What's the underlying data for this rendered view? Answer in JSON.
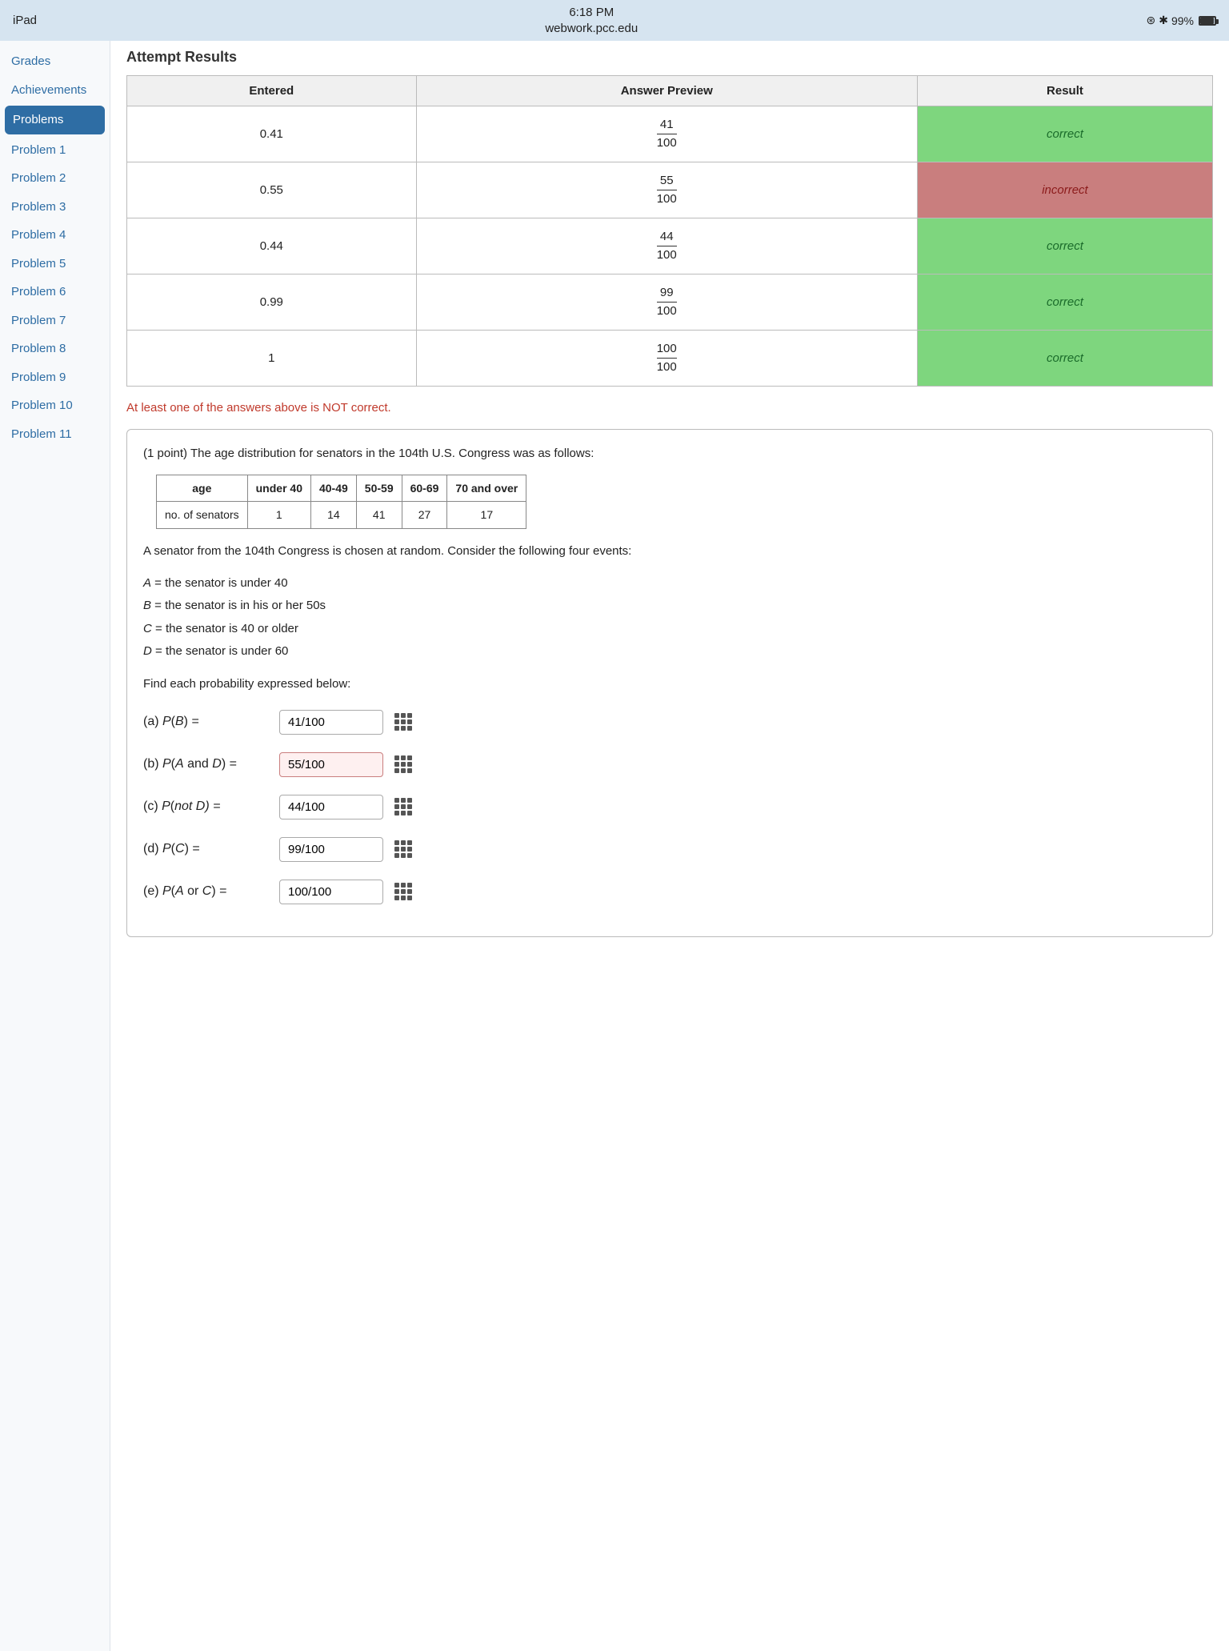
{
  "statusBar": {
    "left": "iPad",
    "centerLine1": "6:18 PM",
    "centerLine2": "webwork.pcc.edu",
    "batteryPercent": "99%"
  },
  "sidebar": {
    "items": [
      {
        "id": "grades",
        "label": "Grades",
        "active": false
      },
      {
        "id": "achievements",
        "label": "Achievements",
        "active": false
      },
      {
        "id": "problems",
        "label": "Problems",
        "active": true
      },
      {
        "id": "problem1",
        "label": "Problem 1",
        "active": false
      },
      {
        "id": "problem2",
        "label": "Problem 2",
        "active": false
      },
      {
        "id": "problem3",
        "label": "Problem 3",
        "active": false
      },
      {
        "id": "problem4",
        "label": "Problem 4",
        "active": false
      },
      {
        "id": "problem5",
        "label": "Problem 5",
        "active": false
      },
      {
        "id": "problem6",
        "label": "Problem 6",
        "active": false
      },
      {
        "id": "problem7",
        "label": "Problem 7",
        "active": false
      },
      {
        "id": "problem8",
        "label": "Problem 8",
        "active": false
      },
      {
        "id": "problem9",
        "label": "Problem 9",
        "active": false
      },
      {
        "id": "problem10",
        "label": "Problem 10",
        "active": false
      },
      {
        "id": "problem11",
        "label": "Problem 11",
        "active": false
      }
    ]
  },
  "pageTitle": "Attempt Results",
  "resultsTable": {
    "headers": [
      "Entered",
      "Answer Preview",
      "Result"
    ],
    "rows": [
      {
        "entered": "0.41",
        "numerator": "41",
        "denominator": "100",
        "result": "correct",
        "status": "correct"
      },
      {
        "entered": "0.55",
        "numerator": "55",
        "denominator": "100",
        "result": "incorrect",
        "status": "incorrect"
      },
      {
        "entered": "0.44",
        "numerator": "44",
        "denominator": "100",
        "result": "correct",
        "status": "correct"
      },
      {
        "entered": "0.99",
        "numerator": "99",
        "denominator": "100",
        "result": "correct",
        "status": "correct"
      },
      {
        "entered": "1",
        "numerator": "100",
        "denominator": "100",
        "result": "correct",
        "status": "correct"
      }
    ]
  },
  "warningMessage": "At least one of the answers above is NOT correct.",
  "problem": {
    "points": "(1 point)",
    "intro": "The age distribution for senators in the 104th U.S. Congress was as follows:",
    "ageTable": {
      "headers": [
        "age",
        "under 40",
        "40-49",
        "50-59",
        "60-69",
        "70 and over"
      ],
      "row": [
        "no. of senators",
        "1",
        "14",
        "41",
        "27",
        "17"
      ]
    },
    "description": "A senator from the 104th Congress is chosen at random. Consider the following four events:",
    "events": [
      {
        "var": "A",
        "desc": "= the senator is under 40"
      },
      {
        "var": "B",
        "desc": "= the senator is in his or her 50s"
      },
      {
        "var": "C",
        "desc": "= the senator is 40 or older"
      },
      {
        "var": "D",
        "desc": "= the senator is under 60"
      }
    ],
    "findText": "Find each probability expressed below:",
    "answers": [
      {
        "label": "(a) P(B) =",
        "value": "41/100",
        "incorrect": false
      },
      {
        "label": "(b) P(A and D) =",
        "value": "55/100",
        "incorrect": true
      },
      {
        "label": "(c) P(not D) =",
        "value": "44/100",
        "incorrect": false
      },
      {
        "label": "(d) P(C) =",
        "value": "99/100",
        "incorrect": false
      },
      {
        "label": "(e) P(A or C) =",
        "value": "100/100",
        "incorrect": false
      }
    ]
  }
}
